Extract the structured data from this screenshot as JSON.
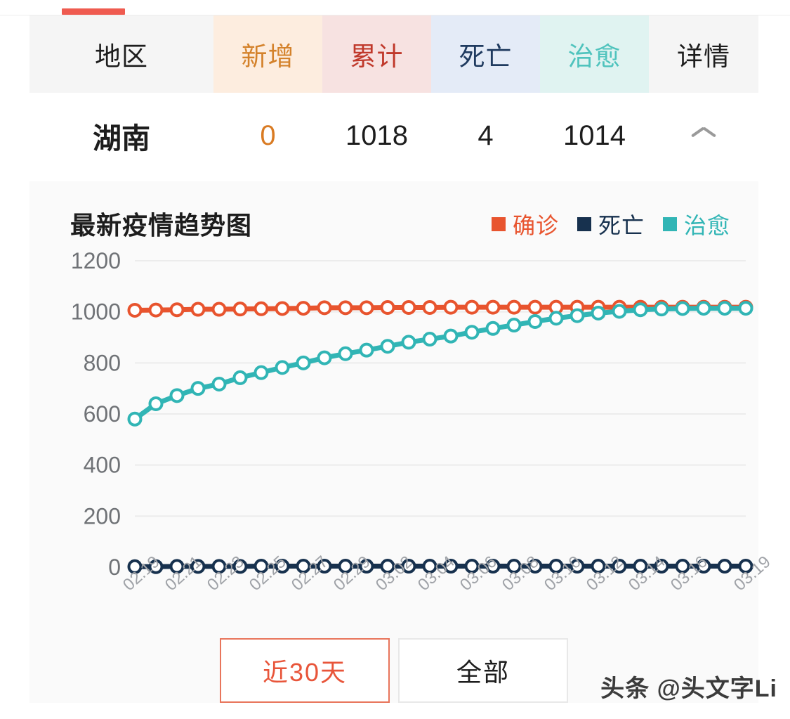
{
  "tab": {
    "indicator_color": "#ef5b50"
  },
  "table": {
    "headers": [
      {
        "label": "地区",
        "name": "region"
      },
      {
        "label": "新增",
        "name": "new"
      },
      {
        "label": "累计",
        "name": "total"
      },
      {
        "label": "死亡",
        "name": "death"
      },
      {
        "label": "治愈",
        "name": "cured"
      },
      {
        "label": "详情",
        "name": "detail"
      }
    ],
    "row": {
      "region": "湖南",
      "new": "0",
      "total": "1018",
      "death": "4",
      "cured": "1014",
      "detail_icon": "chevron-up-icon"
    }
  },
  "chart_card": {
    "title": "最新疫情趋势图",
    "legend": [
      {
        "label": "确诊",
        "color": "#e8542e"
      },
      {
        "label": "死亡",
        "color": "#17314e"
      },
      {
        "label": "治愈",
        "color": "#31b5b5"
      }
    ],
    "buttons": [
      {
        "label": "近30天",
        "active": true
      },
      {
        "label": "全部",
        "active": false
      }
    ]
  },
  "watermark": "头条 @头文字Li",
  "chart_data": {
    "type": "line",
    "title": "最新疫情趋势图",
    "xlabel": "",
    "ylabel": "",
    "ylim": [
      0,
      1200
    ],
    "yticks": [
      0,
      200,
      400,
      600,
      800,
      1000,
      1200
    ],
    "grid": true,
    "legend_position": "top-right",
    "x": [
      "02.19",
      "02.20",
      "02.21",
      "02.22",
      "02.23",
      "02.24",
      "02.25",
      "02.26",
      "02.27",
      "02.28",
      "02.29",
      "03.01",
      "03.02",
      "03.03",
      "03.04",
      "03.05",
      "03.06",
      "03.07",
      "03.08",
      "03.09",
      "03.10",
      "03.11",
      "03.12",
      "03.13",
      "03.14",
      "03.15",
      "03.16",
      "03.17",
      "03.18",
      "03.19"
    ],
    "xtick_labels": [
      "02.19",
      "02.21",
      "02.23",
      "02.25",
      "02.27",
      "02.29",
      "03.02",
      "03.04",
      "03.06",
      "03.08",
      "03.10",
      "03.12",
      "03.14",
      "03.16",
      "03.19"
    ],
    "series": [
      {
        "name": "确诊",
        "color": "#e8542e",
        "values": [
          1006,
          1007,
          1008,
          1010,
          1010,
          1011,
          1012,
          1013,
          1014,
          1016,
          1016,
          1016,
          1017,
          1017,
          1017,
          1018,
          1018,
          1018,
          1018,
          1018,
          1018,
          1018,
          1018,
          1018,
          1018,
          1018,
          1018,
          1018,
          1018,
          1018
        ]
      },
      {
        "name": "死亡",
        "color": "#17314e",
        "values": [
          2,
          2,
          3,
          3,
          3,
          3,
          4,
          4,
          4,
          4,
          4,
          4,
          4,
          4,
          4,
          4,
          4,
          4,
          4,
          4,
          4,
          4,
          4,
          4,
          4,
          4,
          4,
          4,
          4,
          4
        ]
      },
      {
        "name": "治愈",
        "color": "#31b5b5",
        "values": [
          580,
          640,
          672,
          700,
          717,
          742,
          762,
          782,
          800,
          820,
          836,
          850,
          865,
          881,
          893,
          905,
          920,
          935,
          948,
          962,
          975,
          985,
          995,
          1002,
          1008,
          1011,
          1013,
          1014,
          1014,
          1014
        ]
      }
    ]
  }
}
